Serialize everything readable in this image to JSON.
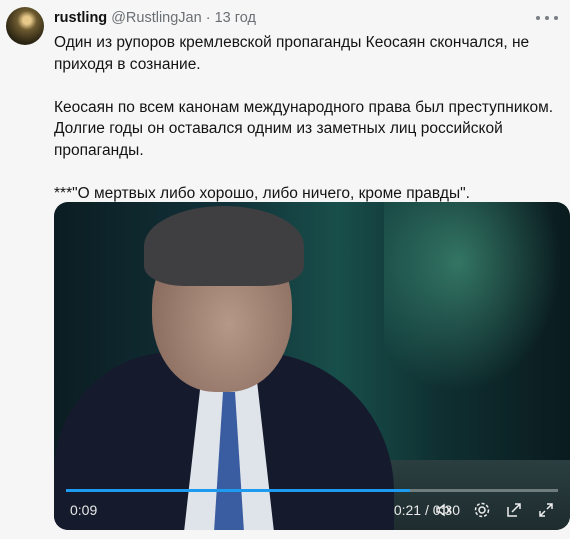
{
  "post": {
    "author_name": "rustling",
    "author_handle": "@RustlingJan",
    "separator": "·",
    "time": "13 год",
    "paragraphs": [
      "Один из рупоров кремлевской пропаганды Кеосаян скончался, не приходя в сознание.",
      "Кеосаян по всем канонам международного права был преступником. Долгие годы он оставался одним из заметных лиц российской пропаганды.",
      "***\"О мертвых либо хорошо, либо ничего, кроме правды\"."
    ]
  },
  "video": {
    "current_time": "0:21",
    "time_separator": "/",
    "duration": "0:30",
    "left_time": "0:09",
    "progress_fraction": 0.7
  },
  "icons": {
    "more": "more-icon",
    "mute": "mute-icon",
    "settings": "gear-icon",
    "popout": "popout-icon",
    "fullscreen": "fullscreen-icon"
  },
  "colors": {
    "accent": "#1d9bf0",
    "muted_text": "#6b6f74"
  }
}
